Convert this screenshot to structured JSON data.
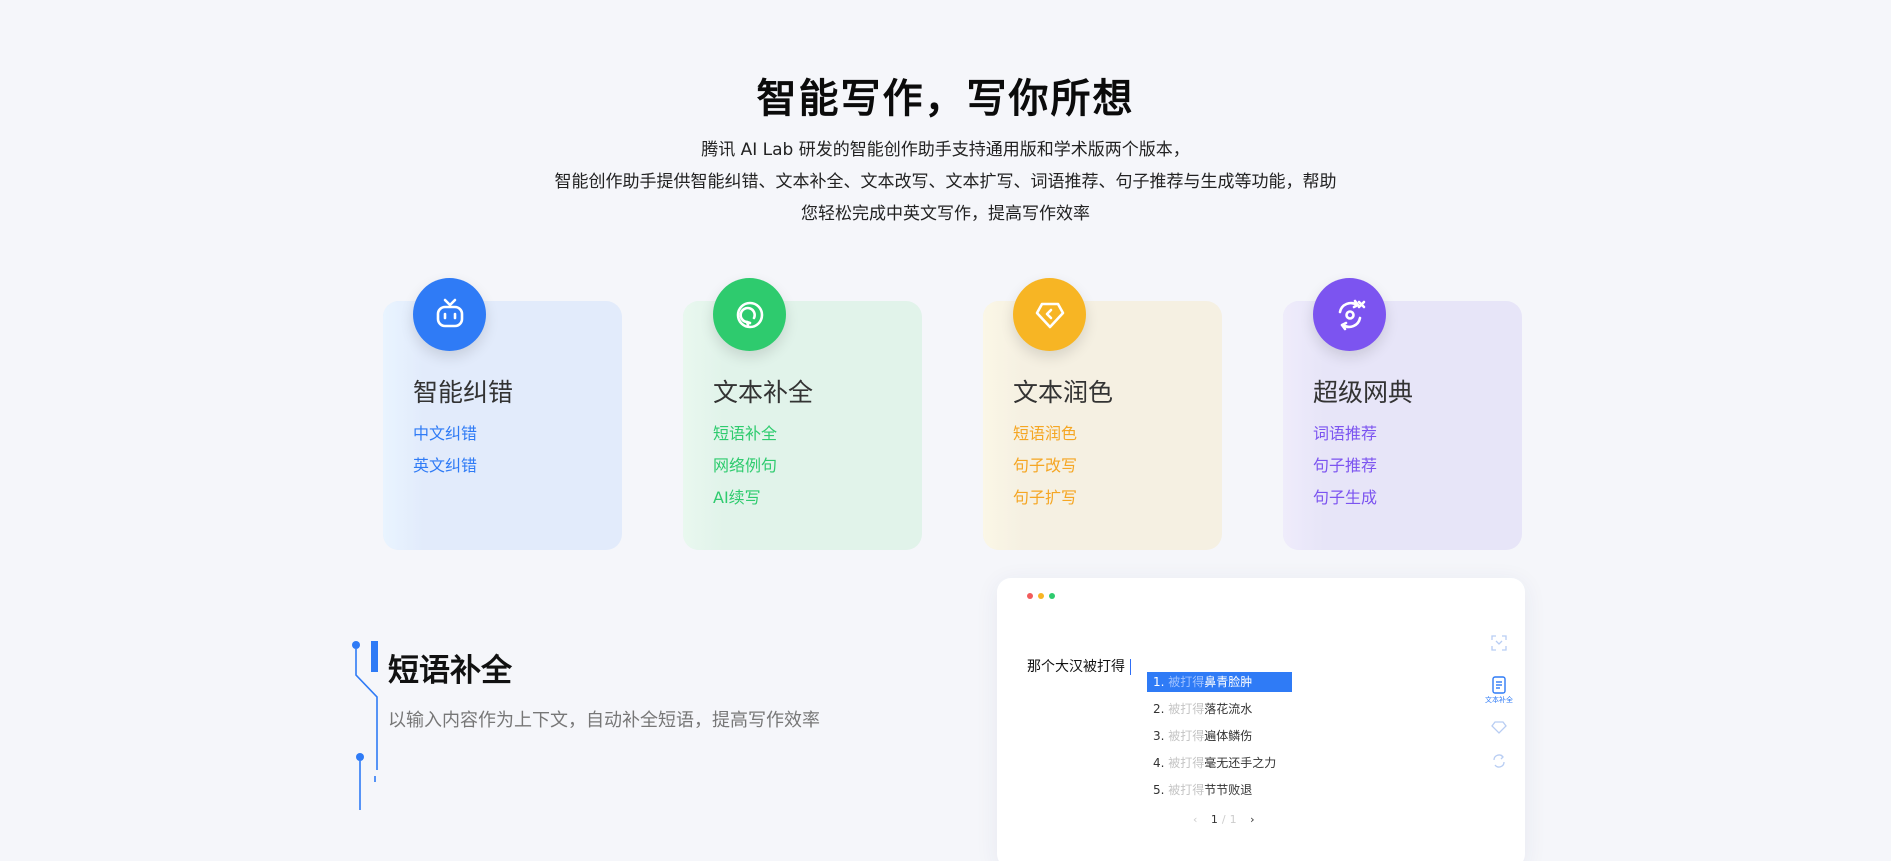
{
  "hero": {
    "title": "智能写作，写你所想",
    "lines": [
      "腾讯 AI Lab 研发的智能创作助手支持通用版和学术版两个版本，",
      "智能创作助手提供智能纠错、文本补全、文本改写、文本扩写、词语推荐、句子推荐与生成等功能，帮助",
      "您轻松完成中英文写作，提高写作效率"
    ]
  },
  "cards": [
    {
      "title": "智能纠错",
      "icon": "robot-face-icon",
      "color": "#2f7bf6",
      "bg": "#e2ebfb",
      "items": [
        "中文纠错",
        "英文纠错"
      ]
    },
    {
      "title": "文本补全",
      "icon": "refresh-circle-icon",
      "color": "#2ecb6e",
      "bg": "#e1f3ea",
      "items": [
        "短语补全",
        "网络例句",
        "AI续写"
      ]
    },
    {
      "title": "文本润色",
      "icon": "diamond-icon",
      "color": "#f7b524",
      "bg": "#f5f0e2",
      "items": [
        "短语润色",
        "句子改写",
        "句子扩写"
      ]
    },
    {
      "title": "超级网典",
      "icon": "cycle-arrows-icon",
      "color": "#7c54f0",
      "bg": "#e7e5f8",
      "items": [
        "词语推荐",
        "句子推荐",
        "句子生成"
      ]
    }
  ],
  "feature": {
    "title": "短语补全",
    "desc": "以输入内容作为上下文，自动补全短语，提高写作效率",
    "accent": "#2f7bf6"
  },
  "editor": {
    "input_text": "那个大汉被打得",
    "suggestions": [
      {
        "num": "1.",
        "prefix": "被打得",
        "completion": "鼻青脸肿"
      },
      {
        "num": "2.",
        "prefix": "被打得",
        "completion": "落花流水"
      },
      {
        "num": "3.",
        "prefix": "被打得",
        "completion": "遍体鳞伤"
      },
      {
        "num": "4.",
        "prefix": "被打得",
        "completion": "毫无还手之力"
      },
      {
        "num": "5.",
        "prefix": "被打得",
        "completion": "节节败退"
      }
    ],
    "pager": {
      "prev": "‹",
      "current": "1",
      "sep": "/",
      "total": "1",
      "next": "›"
    },
    "toolbar_active_label": "文本补全"
  }
}
